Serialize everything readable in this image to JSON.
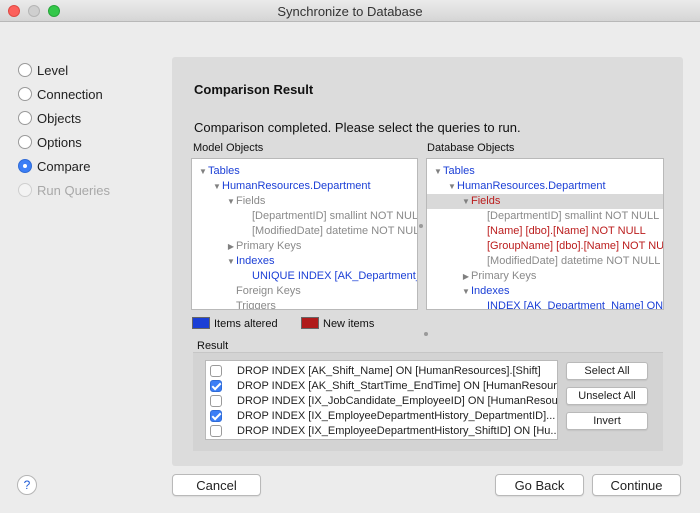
{
  "window": {
    "title": "Synchronize to Database"
  },
  "steps": [
    {
      "label": "Level",
      "state": "normal"
    },
    {
      "label": "Connection",
      "state": "normal"
    },
    {
      "label": "Objects",
      "state": "normal"
    },
    {
      "label": "Options",
      "state": "normal"
    },
    {
      "label": "Compare",
      "state": "active"
    },
    {
      "label": "Run Queries",
      "state": "disabled"
    }
  ],
  "main": {
    "heading": "Comparison Result",
    "message": "Comparison completed. Please select the queries to run.",
    "model_label": "Model Objects",
    "database_label": "Database Objects",
    "model_tree": [
      {
        "text": "Tables",
        "color": "blue",
        "arrow": "down"
      },
      {
        "text": "HumanResources.Department",
        "color": "blue",
        "arrow": "down"
      },
      {
        "text": "Fields",
        "color": "grey",
        "arrow": "down"
      },
      {
        "text": "[DepartmentID] smallint NOT NULL",
        "color": "grey",
        "arrow": ""
      },
      {
        "text": "[ModifiedDate] datetime NOT NULL",
        "color": "grey",
        "arrow": ""
      },
      {
        "text": "Primary Keys",
        "color": "grey",
        "arrow": "right"
      },
      {
        "text": "Indexes",
        "color": "blue",
        "arrow": "down"
      },
      {
        "text": "UNIQUE INDEX [AK_Department_Name]",
        "color": "blue",
        "arrow": ""
      },
      {
        "text": "Foreign Keys",
        "color": "grey",
        "arrow": ""
      },
      {
        "text": "Triggers",
        "color": "grey",
        "arrow": ""
      }
    ],
    "database_tree": [
      {
        "text": "Tables",
        "color": "blue",
        "arrow": "down"
      },
      {
        "text": "HumanResources.Department",
        "color": "blue",
        "arrow": "down"
      },
      {
        "text": "Fields",
        "color": "red",
        "arrow": "down"
      },
      {
        "text": "[DepartmentID] smallint NOT NULL",
        "color": "grey",
        "arrow": ""
      },
      {
        "text": "[Name] [dbo].[Name] NOT NULL",
        "color": "red",
        "arrow": ""
      },
      {
        "text": "[GroupName] [dbo].[Name] NOT NULL",
        "color": "red",
        "arrow": ""
      },
      {
        "text": "[ModifiedDate] datetime NOT NULL",
        "color": "grey",
        "arrow": ""
      },
      {
        "text": "Primary Keys",
        "color": "grey",
        "arrow": "right"
      },
      {
        "text": "Indexes",
        "color": "blue",
        "arrow": "down"
      },
      {
        "text": "INDEX [AK_Department_Name] ON",
        "color": "blue",
        "arrow": ""
      }
    ],
    "legend": {
      "altered_label": "Items altered",
      "altered_color": "#1b3fd6",
      "new_label": "New items",
      "new_color": "#b01b1b"
    },
    "result": {
      "label": "Result",
      "rows": [
        {
          "text": "DROP INDEX [AK_Shift_Name] ON [HumanResources].[Shift]",
          "checked": false
        },
        {
          "text": "DROP INDEX [AK_Shift_StartTime_EndTime] ON [HumanResour...",
          "checked": true
        },
        {
          "text": "DROP INDEX [IX_JobCandidate_EmployeeID] ON [HumanResources...",
          "checked": false
        },
        {
          "text": "DROP INDEX [IX_EmployeeDepartmentHistory_DepartmentID]...",
          "checked": true
        },
        {
          "text": "DROP INDEX [IX_EmployeeDepartmentHistory_ShiftID] ON [Hu...",
          "checked": false
        }
      ],
      "select_all": "Select All",
      "unselect_all": "Unselect All",
      "invert": "Invert"
    }
  },
  "footer": {
    "help": "?",
    "cancel": "Cancel",
    "back": "Go Back",
    "continue": "Continue"
  }
}
